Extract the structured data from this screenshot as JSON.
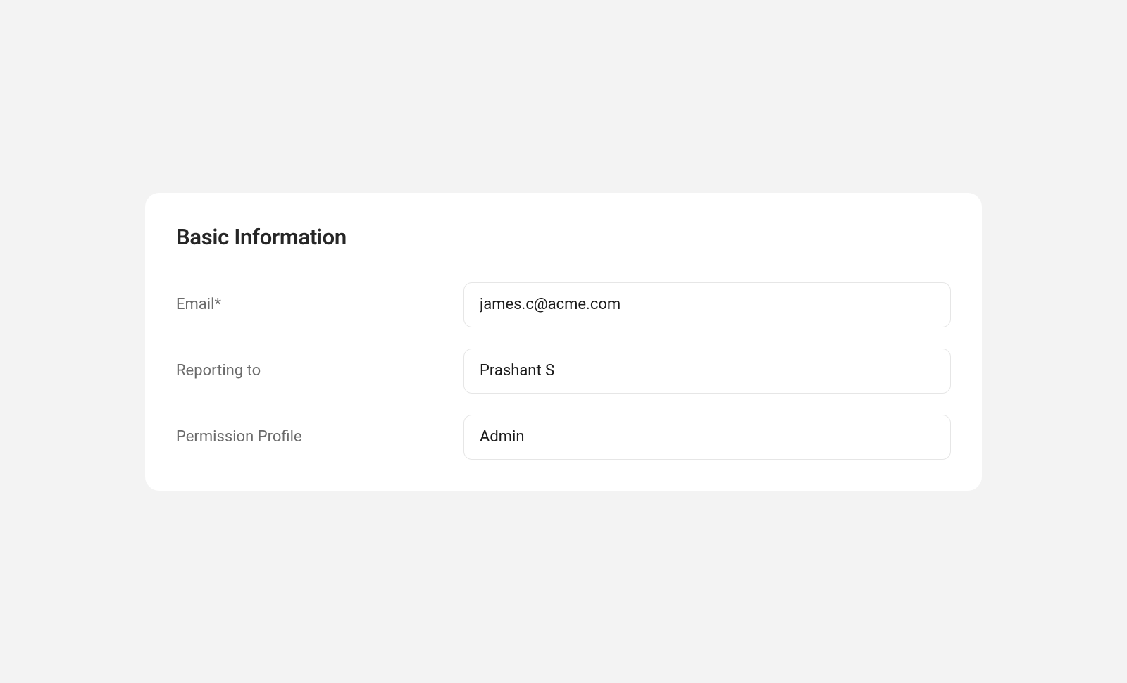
{
  "card": {
    "title": "Basic Information",
    "fields": {
      "email": {
        "label": "Email*",
        "value": "james.c@acme.com"
      },
      "reporting_to": {
        "label": "Reporting to",
        "value": "Prashant S"
      },
      "permission_profile": {
        "label": "Permission Profile",
        "value": "Admin"
      }
    }
  }
}
